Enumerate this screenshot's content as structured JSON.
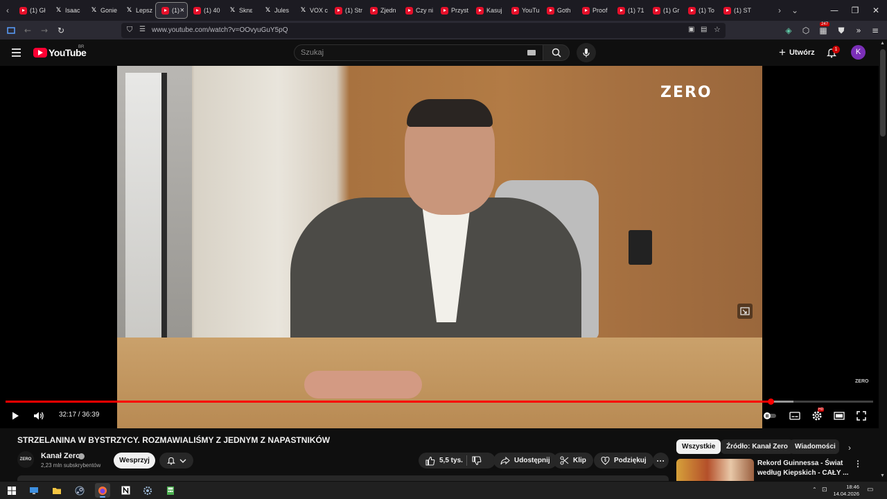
{
  "browser": {
    "tabs": [
      {
        "icon": "youtube-icon",
        "label": "(1) Gł"
      },
      {
        "icon": "x-icon",
        "label": "Isaac"
      },
      {
        "icon": "x-icon",
        "label": "Gonie"
      },
      {
        "icon": "x-icon",
        "label": "Lepsz"
      },
      {
        "icon": "youtube-icon",
        "label": "(1)",
        "active": true
      },
      {
        "icon": "youtube-icon",
        "label": "(1) 40"
      },
      {
        "icon": "x-icon",
        "label": "Sknε"
      },
      {
        "icon": "x-icon",
        "label": "Jules"
      },
      {
        "icon": "x-icon",
        "label": "VOX c"
      },
      {
        "icon": "youtube-icon",
        "label": "(1) Str"
      },
      {
        "icon": "youtube-icon",
        "label": "Zjedn"
      },
      {
        "icon": "youtube-icon",
        "label": "Czy ni"
      },
      {
        "icon": "youtube-icon",
        "label": "Przyst"
      },
      {
        "icon": "youtube-icon",
        "label": "Kasuj"
      },
      {
        "icon": "youtube-icon",
        "label": "YouTu"
      },
      {
        "icon": "youtube-icon",
        "label": "Goth"
      },
      {
        "icon": "youtube-icon",
        "label": "Proof"
      },
      {
        "icon": "youtube-icon",
        "label": "(1) 71"
      },
      {
        "icon": "youtube-icon",
        "label": "(1) Gr"
      },
      {
        "icon": "youtube-icon",
        "label": "(1) To"
      },
      {
        "icon": "youtube-icon",
        "label": "(1) ST"
      }
    ],
    "url": "www.youtube.com/watch?v=OOvyuGuY5pQ",
    "extension_badge": "247"
  },
  "youtube": {
    "logo_text": "YouTube",
    "region": "BR",
    "search_placeholder": "Szukaj",
    "create_label": "Utwórz",
    "notifications_count": "1",
    "avatar_letter": "K"
  },
  "player": {
    "watermark": "ZERO",
    "watermark_small": "ZERO",
    "time_display": "32:17 / 36:39",
    "progress_fraction": 0.882,
    "buffer_fraction": 0.908,
    "hd_badge": "HD"
  },
  "video": {
    "title": "STRZELANINA W BYSTRZYCY. ROZMAWIALIŚMY Z JEDNYM Z NAPASTNIKÓW",
    "channel_name": "Kanał Zero",
    "channel_avatar_text": "ZERO",
    "subscribers": "2,23 mln subskrybentów",
    "support_label": "Wesprzyj",
    "likes": "5,5 tys.",
    "share_label": "Udostępnij",
    "clip_label": "Klip",
    "thanks_label": "Podziękuj"
  },
  "sidebar": {
    "chips": [
      "Wszystkie",
      "Źródło: Kanał Zero",
      "Wiadomości"
    ],
    "rec_title_line1": "Rekord Guinnessa - Świat",
    "rec_title_line2": "według Kiepskich - CAŁY ..."
  },
  "taskbar": {
    "time": "18:46",
    "date": "14.04.2026"
  },
  "colors": {
    "accent_red": "#ff0000",
    "background": "#0f0f0f"
  }
}
